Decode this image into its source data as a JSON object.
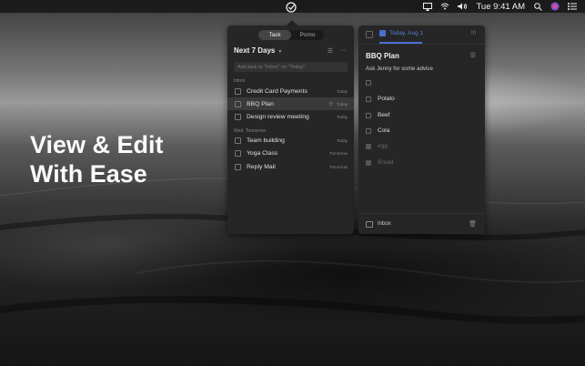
{
  "menubar": {
    "app_icon": "check-circle-icon",
    "airplay_icon": "airplay-icon",
    "wifi_icon": "wifi-icon",
    "volume_icon": "volume-icon",
    "clock": "Tue 9:41 AM",
    "search_icon": "search-icon",
    "siri_icon": "siri-icon",
    "notification_icon": "notification-list-icon"
  },
  "hero": {
    "line1": "View & Edit",
    "line2": "With Ease"
  },
  "list_panel": {
    "tabs": [
      "Task",
      "Pomo"
    ],
    "active_tab": "Task",
    "title": "Next 7 Days",
    "add_placeholder": "Add task to \"Inbox\" on \"Today\"",
    "sections": [
      {
        "header": "Inbox",
        "tasks": [
          {
            "name": "Credit Card Payments",
            "due": "Today"
          },
          {
            "name": "BBQ Plan",
            "due": "Today",
            "selected": true
          },
          {
            "name": "Design review meeting",
            "due": "Today"
          }
        ]
      },
      {
        "header": "Wed, Tomorrow",
        "tasks": [
          {
            "name": "Team building",
            "due": "Today"
          },
          {
            "name": "Yoga Class",
            "due": "Tomorrow"
          },
          {
            "name": "Reply Mail",
            "due": "Tomorrow"
          }
        ]
      }
    ]
  },
  "detail_panel": {
    "date": "Today, Aug 1",
    "title": "BBQ Plan",
    "description": "Ask Jenny for some advice",
    "subtasks": [
      {
        "name": "",
        "done": false
      },
      {
        "name": "Potato",
        "done": false
      },
      {
        "name": "Beef",
        "done": false
      },
      {
        "name": "Cola",
        "done": false
      },
      {
        "name": "egg",
        "done": true
      },
      {
        "name": "Bread",
        "done": true
      }
    ],
    "list_name": "Inbox"
  },
  "colors": {
    "accent": "#4a6fd0",
    "panel": "#262626"
  }
}
